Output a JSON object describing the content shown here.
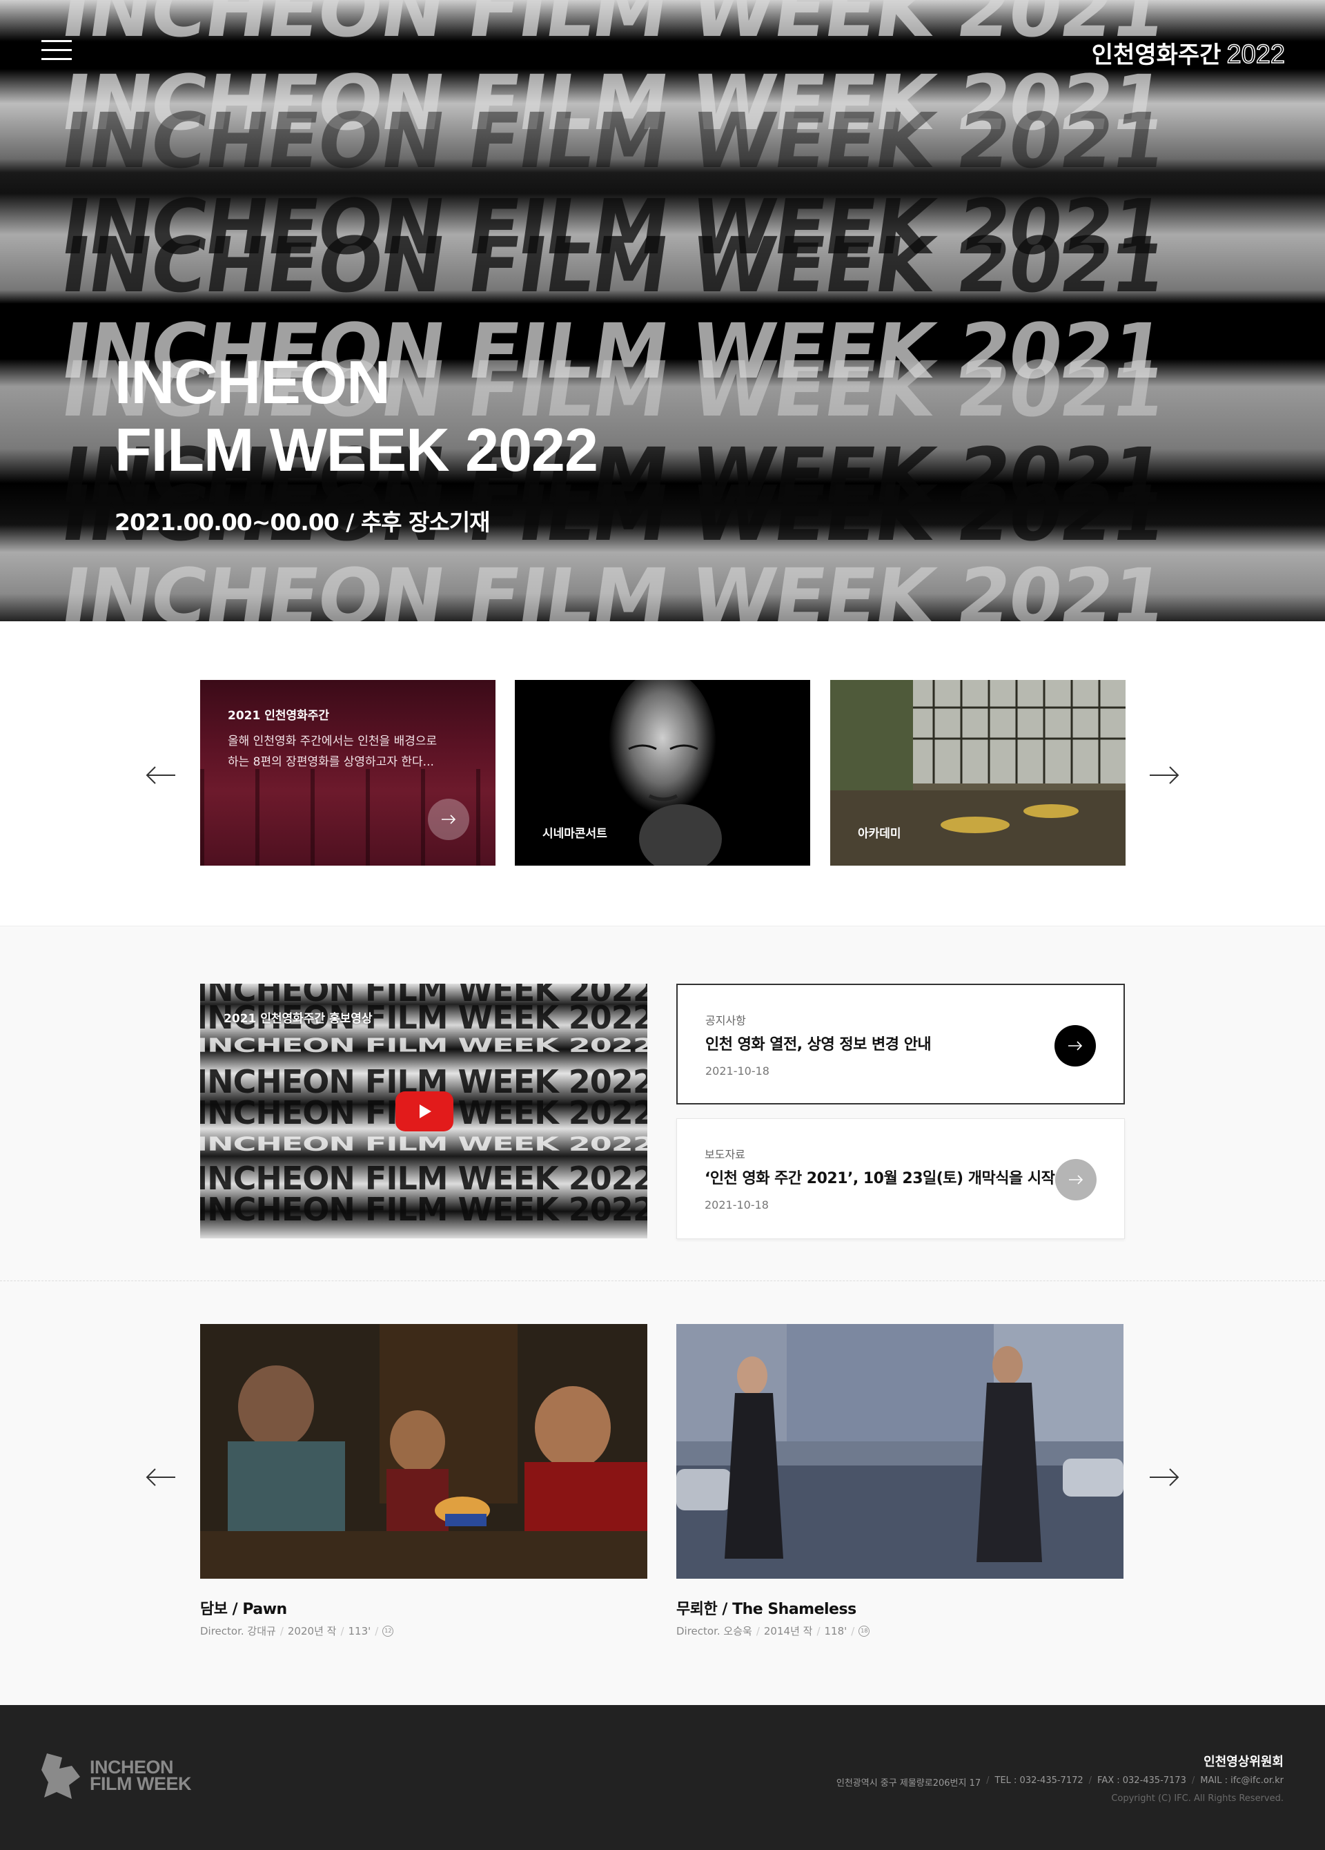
{
  "header": {
    "logo_ko": "인천영화주간",
    "logo_year": "2022"
  },
  "hero": {
    "title_line1": "INCHEON",
    "title_line2": "FILM WEEK 2022",
    "date_place": "2021.00.00~00.00 / 추후 장소기재",
    "background_text": "INCHEON FILM WEEK 2021"
  },
  "cards": [
    {
      "title": "2021 인천영화주간",
      "text_line1": "올해 인천영화 주간에서는 인천을 배경으로",
      "text_line2": "하는 8편의 장편영화를 상영하고자 한다..."
    },
    {
      "caption": "시네마콘서트"
    },
    {
      "caption": "아카데미"
    }
  ],
  "video": {
    "title": "2021 인천영화주간 홍보영상",
    "background_text": "INCHEON FILM WEEK 2022"
  },
  "notices": [
    {
      "category": "공지사항",
      "title": "인천 영화 열전, 상영 정보 변경 안내",
      "date": "2021-10-18"
    },
    {
      "category": "보도자료",
      "title": "‘인천 영화 주간 2021’, 10월 23일(토) 개막식을 시작...",
      "date": "2021-10-18"
    }
  ],
  "films": [
    {
      "name": "담보 / Pawn",
      "director": "Director. 강대규",
      "year": "2020년 작",
      "runtime": "113'",
      "rating": "12"
    },
    {
      "name": "무뢰한 / The Shameless",
      "director": "Director. 오승욱",
      "year": "2014년 작",
      "runtime": "118'",
      "rating": "18"
    }
  ],
  "footer": {
    "logo_line1": "INCHEON",
    "logo_line2": "FILM WEEK",
    "org": "인천영상위원회",
    "address": "인천광역시 중구 제물량로206번지 17",
    "tel": "TEL : 032-435-7172",
    "fax": "FAX : 032-435-7173",
    "mail": "MAIL : ifc@ifc.or.kr",
    "copyright": "Copyright (C) IFC. All Rights Reserved."
  },
  "colors": {
    "accent": "#e21b1b",
    "footer_bg": "#222222",
    "card_red": "#5a1224"
  },
  "icons": [
    "menu-icon",
    "arrow-left-icon",
    "arrow-right-icon",
    "youtube-play-icon"
  ]
}
